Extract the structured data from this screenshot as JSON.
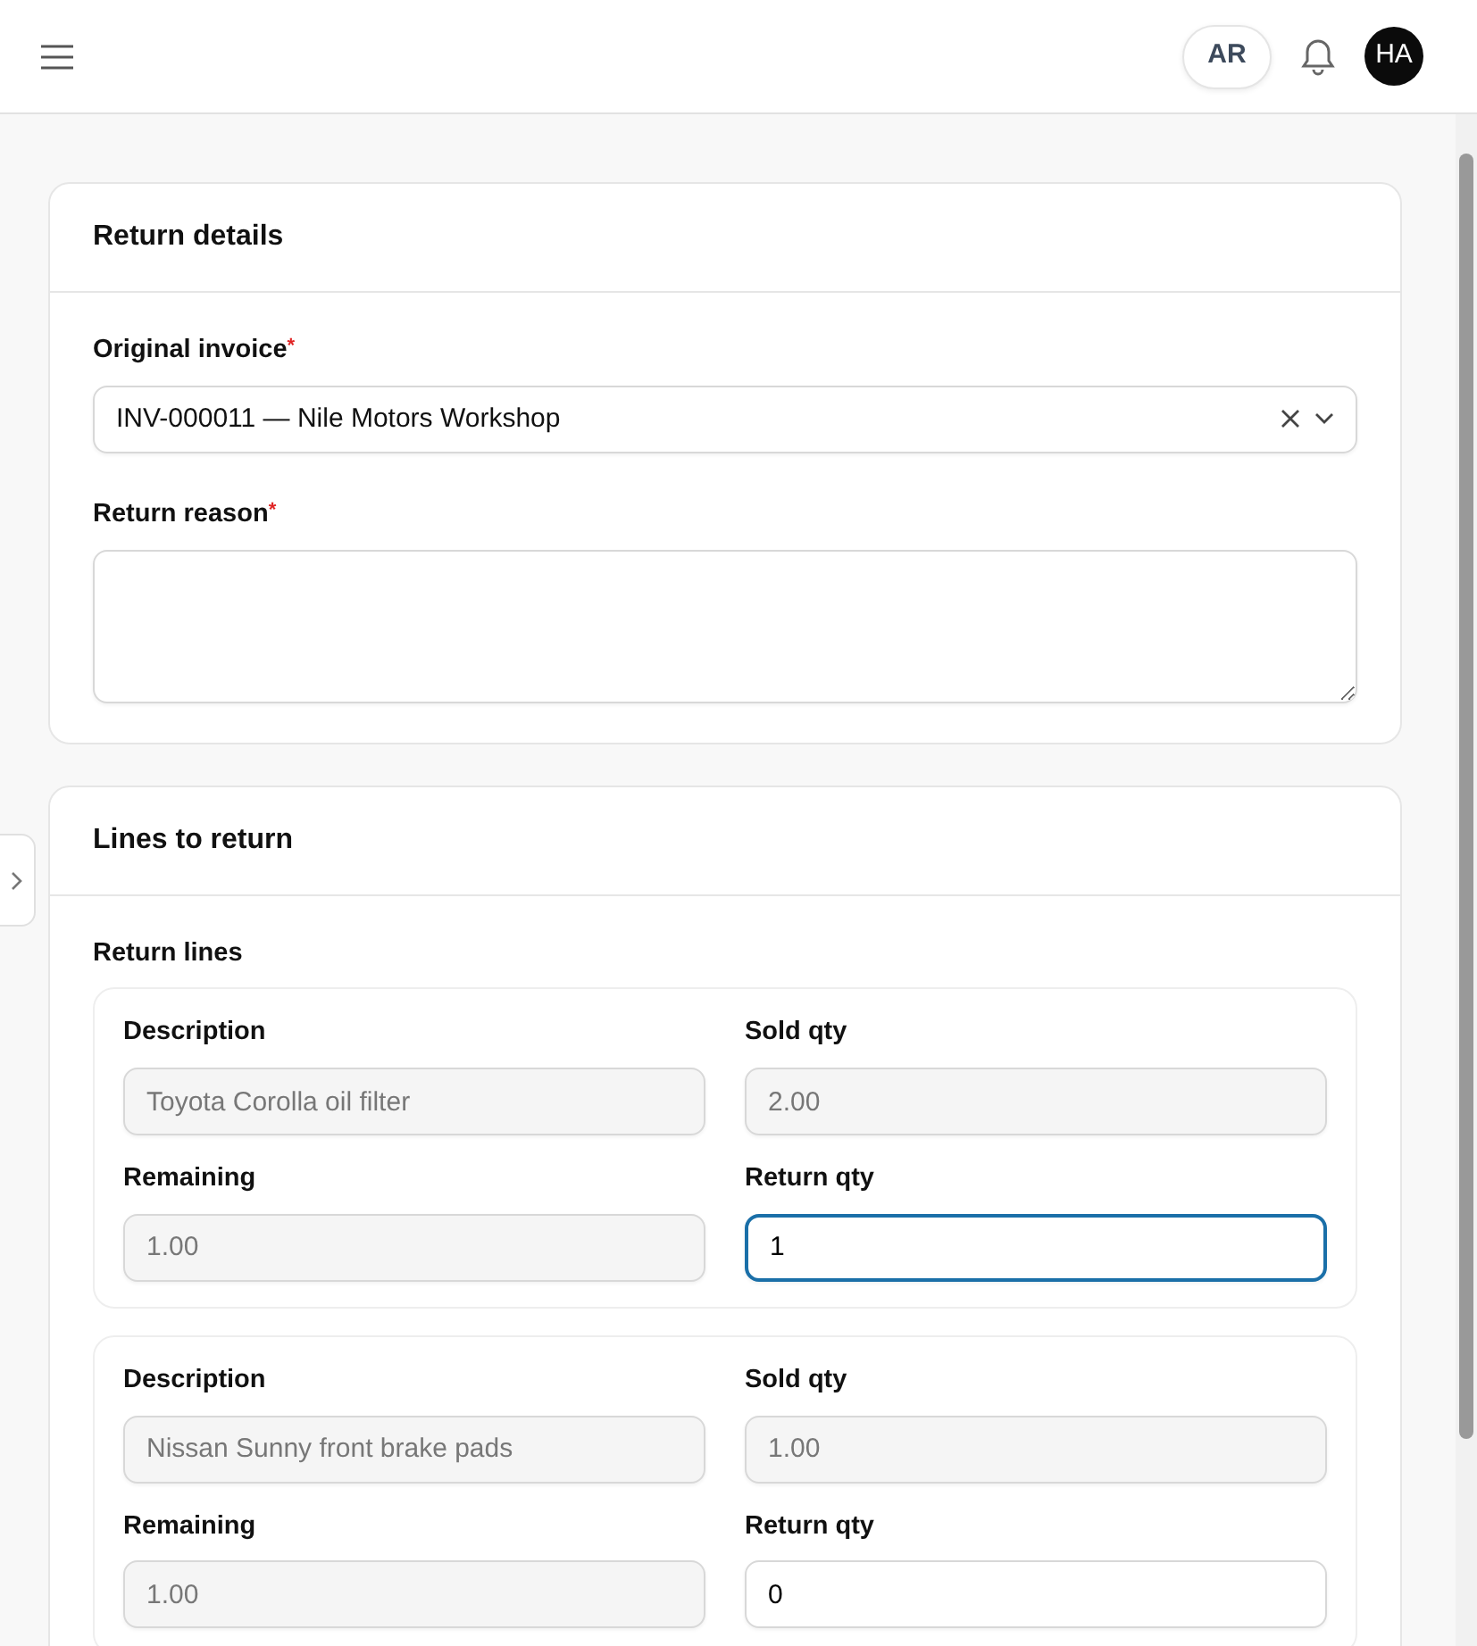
{
  "header": {
    "language": "AR",
    "avatar": "HA"
  },
  "return_details": {
    "title": "Return details",
    "invoice": {
      "label": "Original invoice",
      "required_mark": "*",
      "value": "INV-000011 — Nile Motors Workshop"
    },
    "reason": {
      "label": "Return reason",
      "required_mark": "*"
    }
  },
  "lines_section": {
    "title": "Lines to return",
    "subtitle": "Return lines",
    "lines": [
      {
        "description_label": "Description",
        "description": "Toyota Corolla oil filter",
        "sold_label": "Sold qty",
        "sold_qty": "2.00",
        "remaining_label": "Remaining",
        "remaining": "1.00",
        "return_label": "Return qty",
        "return_qty": "1",
        "focused": true
      },
      {
        "description_label": "Description",
        "description": "Nissan Sunny front brake pads",
        "sold_label": "Sold qty",
        "sold_qty": "1.00",
        "remaining_label": "Remaining",
        "remaining": "1.00",
        "return_label": "Return qty",
        "return_qty": "0",
        "focused": false
      }
    ]
  }
}
